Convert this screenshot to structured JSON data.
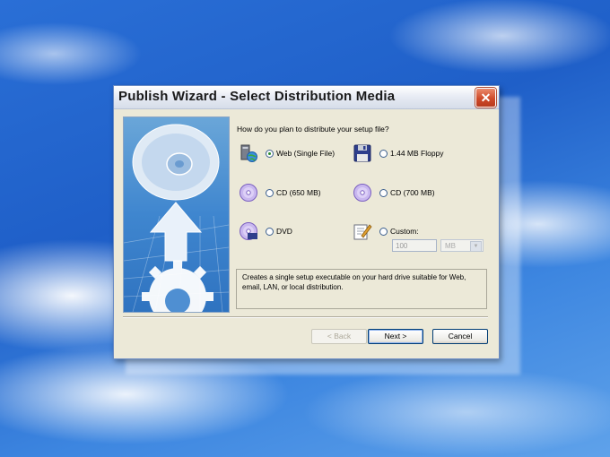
{
  "window": {
    "title": "Publish Wizard - Select Distribution Media"
  },
  "prompt": "How do you plan to distribute your setup file?",
  "options": [
    {
      "label": "Web (Single File)",
      "icon": "web-server-icon",
      "selected": true
    },
    {
      "label": "1.44 MB Floppy",
      "icon": "floppy-disk-icon",
      "selected": false
    },
    {
      "label": "CD (650 MB)",
      "icon": "cd-disc-icon",
      "selected": false
    },
    {
      "label": "CD (700 MB)",
      "icon": "cd-disc-icon",
      "selected": false
    },
    {
      "label": "DVD",
      "icon": "dvd-disc-icon",
      "selected": false
    },
    {
      "label": "Custom:",
      "icon": "custom-edit-icon",
      "selected": false
    }
  ],
  "custom": {
    "size_value": "100",
    "unit": "MB"
  },
  "description": "Creates a single setup executable on your hard drive suitable for Web, email, LAN, or local distribution.",
  "buttons": {
    "back": "< Back",
    "next": "Next >",
    "cancel": "Cancel"
  }
}
